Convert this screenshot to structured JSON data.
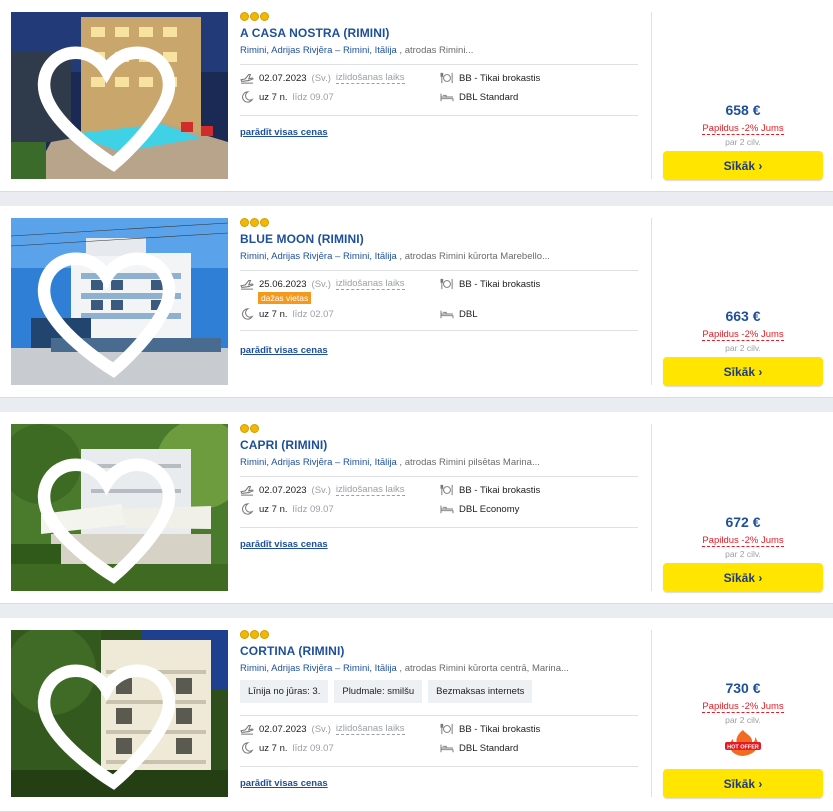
{
  "hotels": [
    {
      "stars": 3,
      "title": "A CASA NOSTRA (RIMINI)",
      "location_link": "Rimini, Adrijas Rivjēra – Rimini, Itālija",
      "location_rest": " , atrodas Rimini...",
      "date": "02.07.2023",
      "day": "(Sv.)",
      "departure_label": "izlidošanas laiks",
      "nights": "uz 7 n.",
      "until": "līdz 09.07",
      "board": "BB - Tikai brokastis",
      "room": "DBL Standard",
      "all_prices": "parādīt visas cenas",
      "price": "658 €",
      "extra": "Papildus -2% Jums",
      "per": "par 2 cilv.",
      "button": "Sīkāk ›"
    },
    {
      "stars": 3,
      "title": "BLUE MOON (RIMINI)",
      "location_link": "Rimini, Adrijas Rivjēra – Rimini, Itālija",
      "location_rest": " , atrodas Rimini kūrorta Marebello...",
      "date": "25.06.2023",
      "day": "(Sv.)",
      "departure_label": "izlidošanas laiks",
      "few_seats": "dažas vietas",
      "nights": "uz 7 n.",
      "until": "līdz 02.07",
      "board": "BB - Tikai brokastis",
      "room": "DBL",
      "all_prices": "parādīt visas cenas",
      "price": "663 €",
      "extra": "Papildus -2% Jums",
      "per": "par 2 cilv.",
      "button": "Sīkāk ›"
    },
    {
      "stars": 2,
      "title": "CAPRI (RIMINI)",
      "location_link": "Rimini, Adrijas Rivjēra – Rimini, Itālija",
      "location_rest": " , atrodas Rimini pilsētas Marina...",
      "date": "02.07.2023",
      "day": "(Sv.)",
      "departure_label": "izlidošanas laiks",
      "nights": "uz 7 n.",
      "until": "līdz 09.07",
      "board": "BB - Tikai brokastis",
      "room": "DBL Economy",
      "all_prices": "parādīt visas cenas",
      "price": "672 €",
      "extra": "Papildus -2% Jums",
      "per": "par 2 cilv.",
      "button": "Sīkāk ›"
    },
    {
      "stars": 3,
      "title": "CORTINA (RIMINI)",
      "location_link": "Rimini, Adrijas Rivjēra – Rimini, Itālija",
      "location_rest": " , atrodas Rimini kūrorta centrā, Marina...",
      "features": [
        "Līnija no jūras: 3.",
        "Pludmale: smilšu",
        "Bezmaksas internets"
      ],
      "date": "02.07.2023",
      "day": "(Sv.)",
      "departure_label": "izlidošanas laiks",
      "nights": "uz 7 n.",
      "until": "līdz 09.07",
      "board": "BB - Tikai brokastis",
      "room": "DBL Standard",
      "all_prices": "parādīt visas cenas",
      "price": "730 €",
      "extra": "Papildus -2% Jums",
      "per": "par 2 cilv.",
      "hot_offer": "HOT OFFER",
      "button": "Sīkāk ›"
    }
  ],
  "colors": {
    "brand_blue": "#1e4f9c",
    "button_yellow": "#ffe500",
    "discount_red": "#e31b23",
    "star_gold": "#f2b705"
  }
}
